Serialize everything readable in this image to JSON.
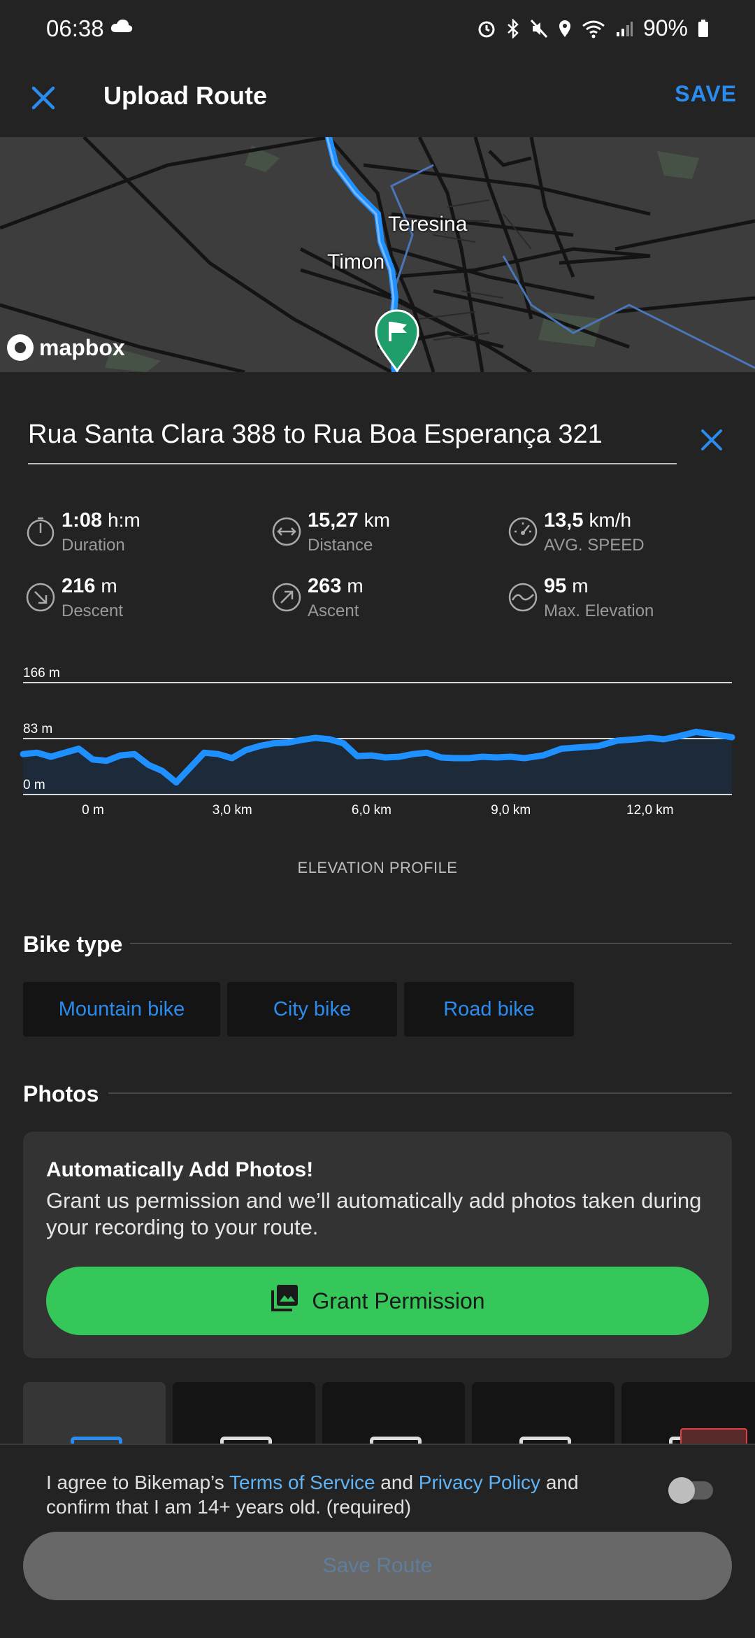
{
  "status_bar": {
    "time": "06:38",
    "battery": "90%"
  },
  "header": {
    "title": "Upload Route",
    "save_label": "SAVE"
  },
  "map": {
    "labels": [
      "Teresina",
      "Timon"
    ],
    "attribution": "mapbox"
  },
  "route": {
    "name": "Rua Santa Clara 388 to Rua Boa Esperança 321"
  },
  "stats": [
    {
      "value": "1:08",
      "unit": "h:m",
      "label": "Duration",
      "icon": "stopwatch-icon"
    },
    {
      "value": "15,27",
      "unit": "km",
      "label": "Distance",
      "icon": "distance-icon"
    },
    {
      "value": "13,5",
      "unit": "km/h",
      "label": "AVG. SPEED",
      "icon": "speedometer-icon"
    },
    {
      "value": "216",
      "unit": "m",
      "label": "Descent",
      "icon": "descent-arrow-icon"
    },
    {
      "value": "263",
      "unit": "m",
      "label": "Ascent",
      "icon": "ascent-arrow-icon"
    },
    {
      "value": "95",
      "unit": "m",
      "label": "Max. Elevation",
      "icon": "elevation-wave-icon"
    }
  ],
  "chart_data": {
    "type": "area",
    "title": "",
    "caption": "ELEVATION PROFILE",
    "y_ticks": [
      "166 m",
      "83 m",
      "0 m"
    ],
    "x_ticks": [
      "0 m",
      "3,0 km",
      "6,0 km",
      "9,0 km",
      "12,0 km"
    ],
    "xlim": [
      0,
      15.27
    ],
    "ylim": [
      0,
      166
    ],
    "x": [
      0,
      0.3,
      0.6,
      0.9,
      1.2,
      1.5,
      1.8,
      2.1,
      2.4,
      2.7,
      3.0,
      3.3,
      3.6,
      3.9,
      4.2,
      4.5,
      4.8,
      5.1,
      5.4,
      5.7,
      6.0,
      6.3,
      6.6,
      6.9,
      7.2,
      7.5,
      7.8,
      8.1,
      8.4,
      8.7,
      9.0,
      9.3,
      9.6,
      9.9,
      10.2,
      10.5,
      10.8,
      11.2,
      11.6,
      12.0,
      12.4,
      12.8,
      13.2,
      13.5,
      13.8,
      14.1,
      14.5,
      15.0,
      15.27
    ],
    "y": [
      60,
      62,
      56,
      62,
      68,
      52,
      50,
      58,
      60,
      44,
      35,
      18,
      40,
      62,
      60,
      54,
      66,
      72,
      76,
      77,
      81,
      84,
      82,
      76,
      57,
      58,
      55,
      56,
      60,
      62,
      55,
      54,
      54,
      56,
      55,
      56,
      54,
      58,
      68,
      70,
      72,
      80,
      82,
      84,
      82,
      86,
      93,
      88,
      85
    ],
    "accent_color": "#1e90ff"
  },
  "bike_type": {
    "title": "Bike type",
    "options": [
      "Mountain bike",
      "City bike",
      "Road bike"
    ]
  },
  "photos": {
    "title": "Photos",
    "card_title": "Automatically Add Photos!",
    "card_text": "Grant us permission and we’ll automatically add photos taken during your recording to your route.",
    "grant_label": "Grant Permission"
  },
  "consent": {
    "prefix": "I agree to Bikemap’s ",
    "tos": "Terms of Service",
    "and": " and ",
    "privacy": "Privacy Policy",
    "suffix": " and confirm that I am 14+ years old. (required)"
  },
  "save_route_label": "Save Route"
}
